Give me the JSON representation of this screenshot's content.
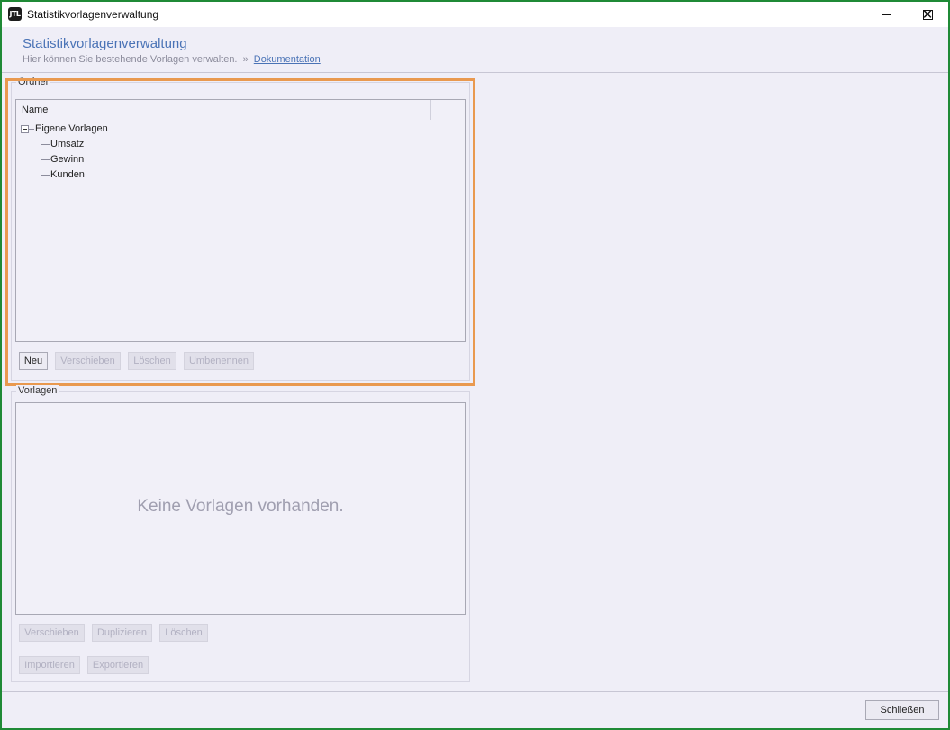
{
  "window": {
    "title": "Statistikvorlagenverwaltung",
    "icon": "jtl-app-icon",
    "icon_text": "JTL",
    "controls": {
      "minimize_icon": "minimize-icon",
      "maximize_icon": "maximize-icon",
      "close_icon": "close-icon",
      "close_glyph": "✕"
    }
  },
  "header": {
    "title": "Statistikvorlagenverwaltung",
    "subtitle": "Hier können Sie bestehende Vorlagen verwalten.",
    "separator": "»",
    "link": "Dokumentation"
  },
  "ordner": {
    "legend": "Ordner",
    "column_header": "Name",
    "root": {
      "label": "Eigene Vorlagen",
      "expanded": true
    },
    "children": [
      "Umsatz",
      "Gewinn",
      "Kunden"
    ],
    "buttons": [
      {
        "label": "Neu",
        "enabled": true
      },
      {
        "label": "Verschieben",
        "enabled": false
      },
      {
        "label": "Löschen",
        "enabled": false
      },
      {
        "label": "Umbenennen",
        "enabled": false
      }
    ]
  },
  "vorlagen": {
    "legend": "Vorlagen",
    "empty_message": "Keine Vorlagen vorhanden.",
    "buttons_row1": [
      {
        "label": "Verschieben",
        "enabled": false
      },
      {
        "label": "Duplizieren",
        "enabled": false
      },
      {
        "label": "Löschen",
        "enabled": false
      }
    ],
    "buttons_row2": [
      {
        "label": "Importieren",
        "enabled": false
      },
      {
        "label": "Exportieren",
        "enabled": false
      }
    ]
  },
  "footer": {
    "close_label": "Schließen"
  },
  "colors": {
    "frame": "#1f8a36",
    "background": "#efeef7",
    "header_title": "#4a73b6",
    "highlight_border": "#e9994f",
    "disabled_text": "#b2b1c2"
  }
}
